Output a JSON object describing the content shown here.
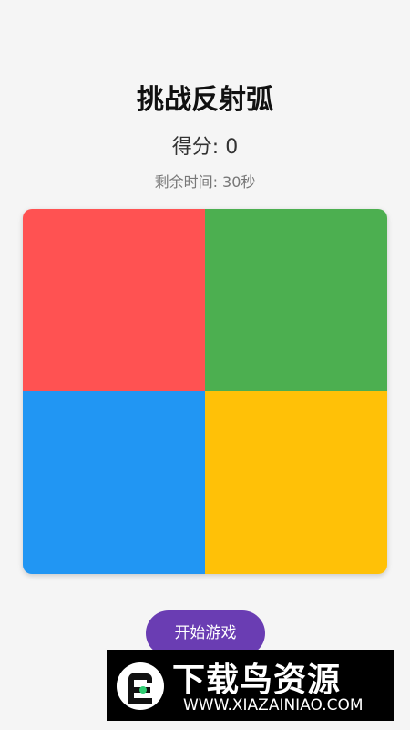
{
  "header": {
    "title": "挑战反射弧",
    "score_text": "得分: 0",
    "timer_text": "剩余时间: 30秒"
  },
  "board": {
    "tiles": [
      {
        "name": "red",
        "color": "#ff5252"
      },
      {
        "name": "green",
        "color": "#4caf50"
      },
      {
        "name": "blue",
        "color": "#2196f3"
      },
      {
        "name": "yellow",
        "color": "#ffc107"
      }
    ]
  },
  "controls": {
    "start_label": "开始游戏",
    "accent_color": "#6a3db3"
  },
  "watermark": {
    "name": "下载鸟资源",
    "url": "WWW.XIAZAINIAO.COM",
    "logo_icon": "bird-logo-icon"
  }
}
